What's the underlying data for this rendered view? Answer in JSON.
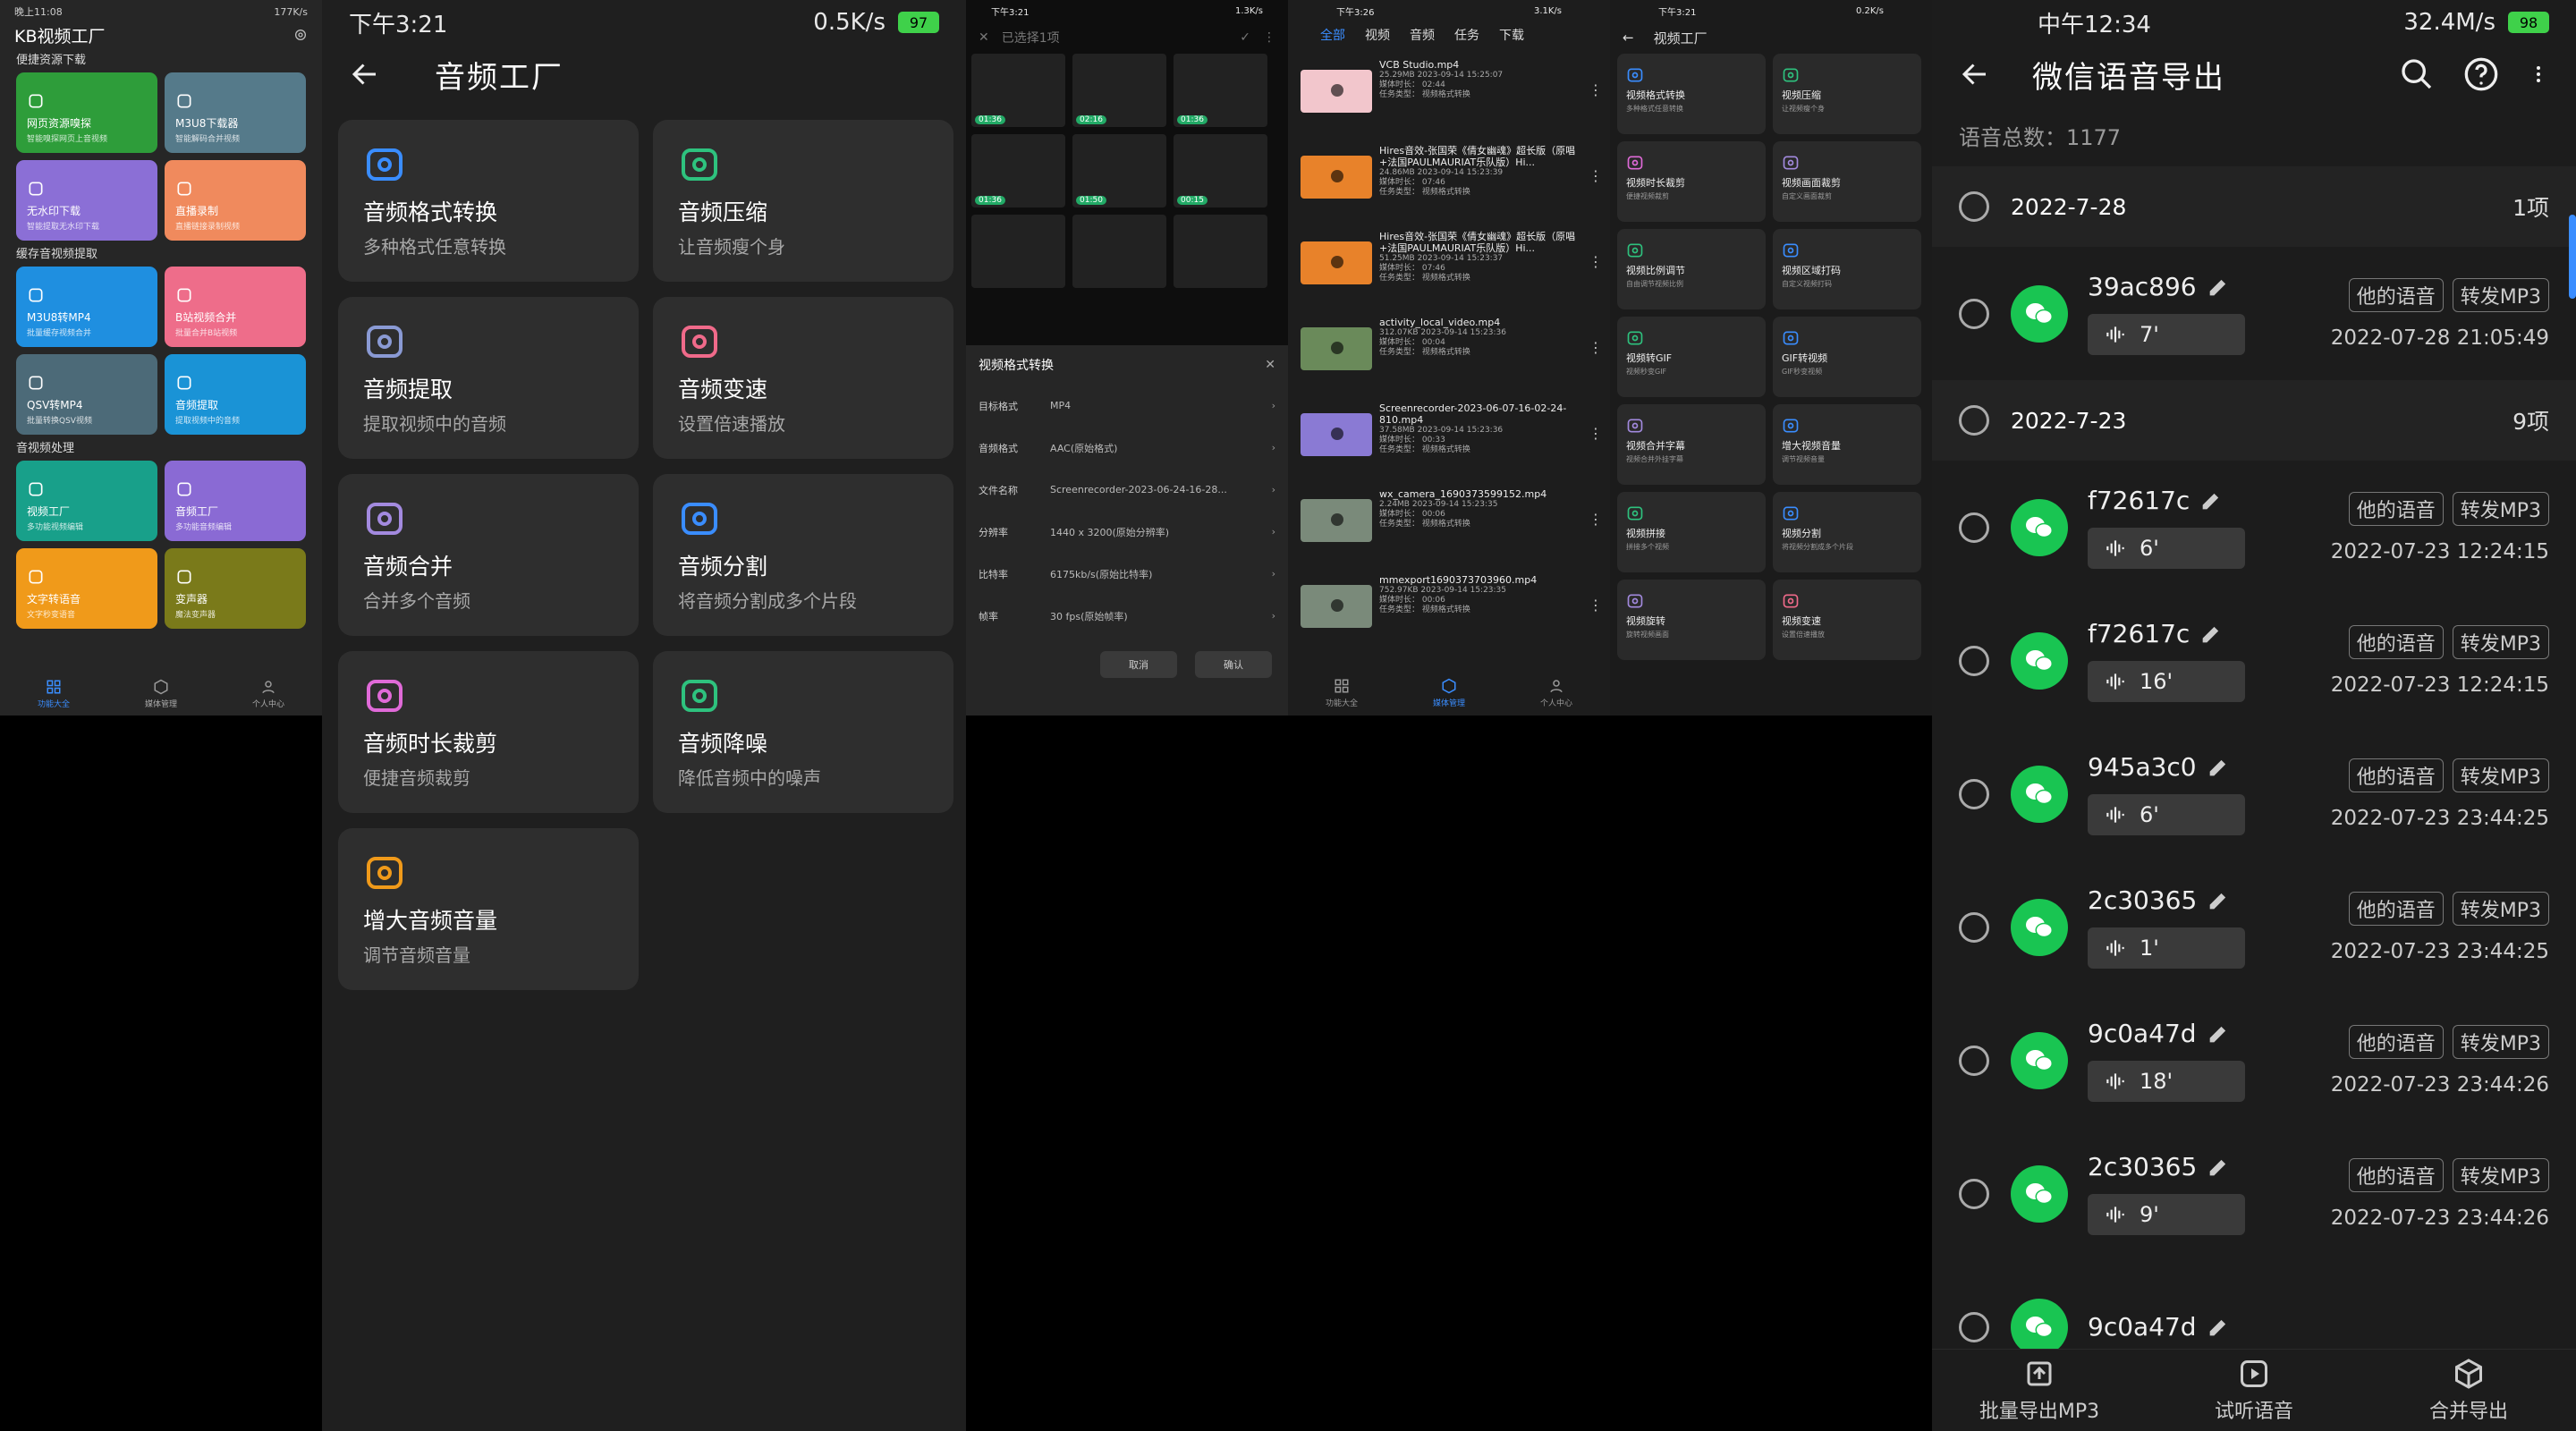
{
  "s1": {
    "status": {
      "time": "晚上11:08",
      "net": "177K/s"
    },
    "title": "KB视频工厂",
    "sections": [
      {
        "title": "便捷资源下载",
        "tiles": [
          {
            "t": "网页资源嗅探",
            "s": "智能嗅探网页上音视频",
            "color": "#2e9d3a"
          },
          {
            "t": "M3U8下载器",
            "s": "智能解码合并视频",
            "color": "#557a8a"
          },
          {
            "t": "无水印下载",
            "s": "智能提取无水印下载",
            "color": "#8b6fd6"
          },
          {
            "t": "直播录制",
            "s": "直播链接录制视频",
            "color": "#f08a5d"
          }
        ]
      },
      {
        "title": "缓存音视频提取",
        "tiles": [
          {
            "t": "M3U8转MP4",
            "s": "批量缓存视频合并",
            "color": "#1f8fe0"
          },
          {
            "t": "B站视频合并",
            "s": "批量合并B站视频",
            "color": "#ee6d8a"
          },
          {
            "t": "QSV转MP4",
            "s": "批量转换QSV视频",
            "color": "#4c6a78"
          },
          {
            "t": "音频提取",
            "s": "提取视频中的音频",
            "color": "#1a93d6"
          }
        ]
      },
      {
        "title": "音视频处理",
        "tiles": [
          {
            "t": "视频工厂",
            "s": "多功能视频编辑",
            "color": "#18a08a"
          },
          {
            "t": "音频工厂",
            "s": "多功能音频编辑",
            "color": "#8a6ad4"
          },
          {
            "t": "文字转语音",
            "s": "文字秒变语音",
            "color": "#f09a1a"
          },
          {
            "t": "变声器",
            "s": "魔法变声器",
            "color": "#7a7a1a"
          }
        ]
      }
    ],
    "nav": [
      "功能大全",
      "媒体管理",
      "个人中心"
    ]
  },
  "s2": {
    "status": {
      "time": "下午3:21",
      "net": "0.5K/s",
      "battery": "97"
    },
    "title": "音频工厂",
    "cards": [
      {
        "t": "音频格式转换",
        "s": "多种格式任意转换",
        "icon": "audio-convert-icon",
        "color": "#3a8dff"
      },
      {
        "t": "音频压缩",
        "s": "让音频瘦个身",
        "icon": "compress-icon",
        "color": "#2ec27e"
      },
      {
        "t": "音频提取",
        "s": "提取视频中的音频",
        "icon": "audio-extract-icon",
        "color": "#8a9ad4"
      },
      {
        "t": "音频变速",
        "s": "设置倍速播放",
        "icon": "speed-icon",
        "color": "#f06a8a"
      },
      {
        "t": "音频合并",
        "s": "合并多个音频",
        "icon": "merge-icon",
        "color": "#a38adf"
      },
      {
        "t": "音频分割",
        "s": "将音频分割成多个片段",
        "icon": "crop-icon",
        "color": "#3a8dff"
      },
      {
        "t": "音频时长裁剪",
        "s": "便捷音频裁剪",
        "icon": "scissors-icon",
        "color": "#e06ad8"
      },
      {
        "t": "音频降噪",
        "s": "降低音频中的噪声",
        "icon": "headphones-icon",
        "color": "#2ec27e"
      },
      {
        "t": "增大音频音量",
        "s": "调节音频音量",
        "icon": "volume-icon",
        "color": "#f09a1a"
      }
    ]
  },
  "s3": {
    "status": {
      "time": "下午3:21",
      "net": "1.3K/s"
    },
    "selected": "已选择1项",
    "durations": [
      "01:36",
      "02:16",
      "01:36",
      "01:36",
      "01:50",
      "00:15"
    ],
    "sheet": {
      "title": "视频格式转换",
      "rows": [
        {
          "k": "目标格式",
          "v": "MP4"
        },
        {
          "k": "音频格式",
          "v": "AAC(原始格式)"
        },
        {
          "k": "文件名称",
          "v": "Screenrecorder-2023-06-24-16-28..."
        },
        {
          "k": "分辨率",
          "v": "1440 x 3200(原始分辨率)"
        },
        {
          "k": "比特率",
          "v": "6175kb/s(原始比特率)"
        },
        {
          "k": "帧率",
          "v": "30 fps(原始帧率)"
        }
      ],
      "cancel": "取消",
      "ok": "确认"
    }
  },
  "s4": {
    "status": {
      "time": "下午3:26",
      "net": "3.1K/s"
    },
    "tabs": [
      "全部",
      "视频",
      "音频",
      "任务",
      "下载"
    ],
    "items": [
      {
        "n": "VCB Studio.mp4",
        "m1": "25.29MB 2023-09-14 15:25:07",
        "m2": "媒体时长： 02:44",
        "m3": "任务类型： 视频格式转换",
        "color": "#f2c6cc"
      },
      {
        "n": "Hires音效-张国荣《倩女幽魂》超长版（原唱+法国PAULMAURIAT乐队版）Hi...",
        "m1": "24.86MB 2023-09-14 15:23:39",
        "m2": "媒体时长： 07:46",
        "m3": "任务类型： 视频格式转换",
        "color": "#e8822a"
      },
      {
        "n": "Hires音效-张国荣《倩女幽魂》超长版（原唱+法国PAULMAURIAT乐队版）Hi...",
        "m1": "51.25MB 2023-09-14 15:23:37",
        "m2": "媒体时长： 07:46",
        "m3": "任务类型： 视频格式转换",
        "color": "#e8822a"
      },
      {
        "n": "activity_local_video.mp4",
        "m1": "312.07KB 2023-09-14 15:23:36",
        "m2": "媒体时长： 00:04",
        "m3": "任务类型： 视频格式转换",
        "color": "#6a8a5a"
      },
      {
        "n": "Screenrecorder-2023-06-07-16-02-24-810.mp4",
        "m1": "37.58MB 2023-09-14 15:23:36",
        "m2": "媒体时长： 00:33",
        "m3": "任务类型： 视频格式转换",
        "color": "#8a7ad4"
      },
      {
        "n": "wx_camera_1690373599152.mp4",
        "m1": "2.24MB 2023-09-14 15:23:35",
        "m2": "媒体时长： 00:06",
        "m3": "任务类型： 视频格式转换",
        "color": "#7a8a7a"
      },
      {
        "n": "mmexport1690373703960.mp4",
        "m1": "752.97KB 2023-09-14 15:23:35",
        "m2": "媒体时长： 00:06",
        "m3": "任务类型： 视频格式转换",
        "color": "#7a8a7a"
      }
    ],
    "nav": [
      "功能大全",
      "媒体管理",
      "个人中心"
    ]
  },
  "s5": {
    "status": {
      "time": "下午3:21",
      "net": "0.2K/s"
    },
    "title": "视频工厂",
    "cards": [
      {
        "t": "视频格式转换",
        "s": "多种格式任意转换",
        "color": "#3a8dff"
      },
      {
        "t": "视频压缩",
        "s": "让视频瘦个身",
        "color": "#2ec27e"
      },
      {
        "t": "视频时长裁剪",
        "s": "便捷视频裁剪",
        "color": "#e06ad8"
      },
      {
        "t": "视频画面裁剪",
        "s": "自定义画面裁剪",
        "color": "#a38adf"
      },
      {
        "t": "视频比例调节",
        "s": "自由调节视频比例",
        "color": "#2ec27e"
      },
      {
        "t": "视频区域打码",
        "s": "自定义视频打码",
        "color": "#3a8dff"
      },
      {
        "t": "视频转GIF",
        "s": "视频秒变GIF",
        "color": "#2ec27e"
      },
      {
        "t": "GIF转视频",
        "s": "GIF秒变视频",
        "color": "#3a8dff"
      },
      {
        "t": "视频合并字幕",
        "s": "视频合并外挂字幕",
        "color": "#a38adf"
      },
      {
        "t": "增大视频音量",
        "s": "调节视频音量",
        "color": "#3a8dff"
      },
      {
        "t": "视频拼接",
        "s": "拼接多个视频",
        "color": "#2ec27e"
      },
      {
        "t": "视频分割",
        "s": "将视频分割成多个片段",
        "color": "#3a8dff"
      },
      {
        "t": "视频旋转",
        "s": "旋转视频画面",
        "color": "#a38adf"
      },
      {
        "t": "视频变速",
        "s": "设置倍速播放",
        "color": "#f06a8a"
      }
    ]
  },
  "s6": {
    "status": {
      "time": "中午12:34",
      "net": "32.4M/s",
      "battery": "98"
    },
    "title": "微信语音导出",
    "count": "语音总数：1177",
    "groups": [
      {
        "date": "2022-7-28",
        "count": "1项",
        "recs": [
          {
            "id": "39ac896",
            "dur": "7'",
            "time": "2022-07-28 21:05:49"
          }
        ]
      },
      {
        "date": "2022-7-23",
        "count": "9项",
        "recs": [
          {
            "id": "f72617c",
            "dur": "6'",
            "time": "2022-07-23 12:24:15"
          },
          {
            "id": "f72617c",
            "dur": "16'",
            "time": "2022-07-23 12:24:15"
          },
          {
            "id": "945a3c0",
            "dur": "6'",
            "time": "2022-07-23 23:44:25"
          },
          {
            "id": "2c30365",
            "dur": "1'",
            "time": "2022-07-23 23:44:25"
          },
          {
            "id": "9c0a47d",
            "dur": "18'",
            "time": "2022-07-23 23:44:26"
          },
          {
            "id": "2c30365",
            "dur": "9'",
            "time": "2022-07-23 23:44:26"
          },
          {
            "id": "9c0a47d",
            "dur": "",
            "time": ""
          }
        ]
      }
    ],
    "tag1": "他的语音",
    "tag2": "转发MP3",
    "bottom": [
      "批量导出MP3",
      "试听语音",
      "合并导出"
    ]
  }
}
